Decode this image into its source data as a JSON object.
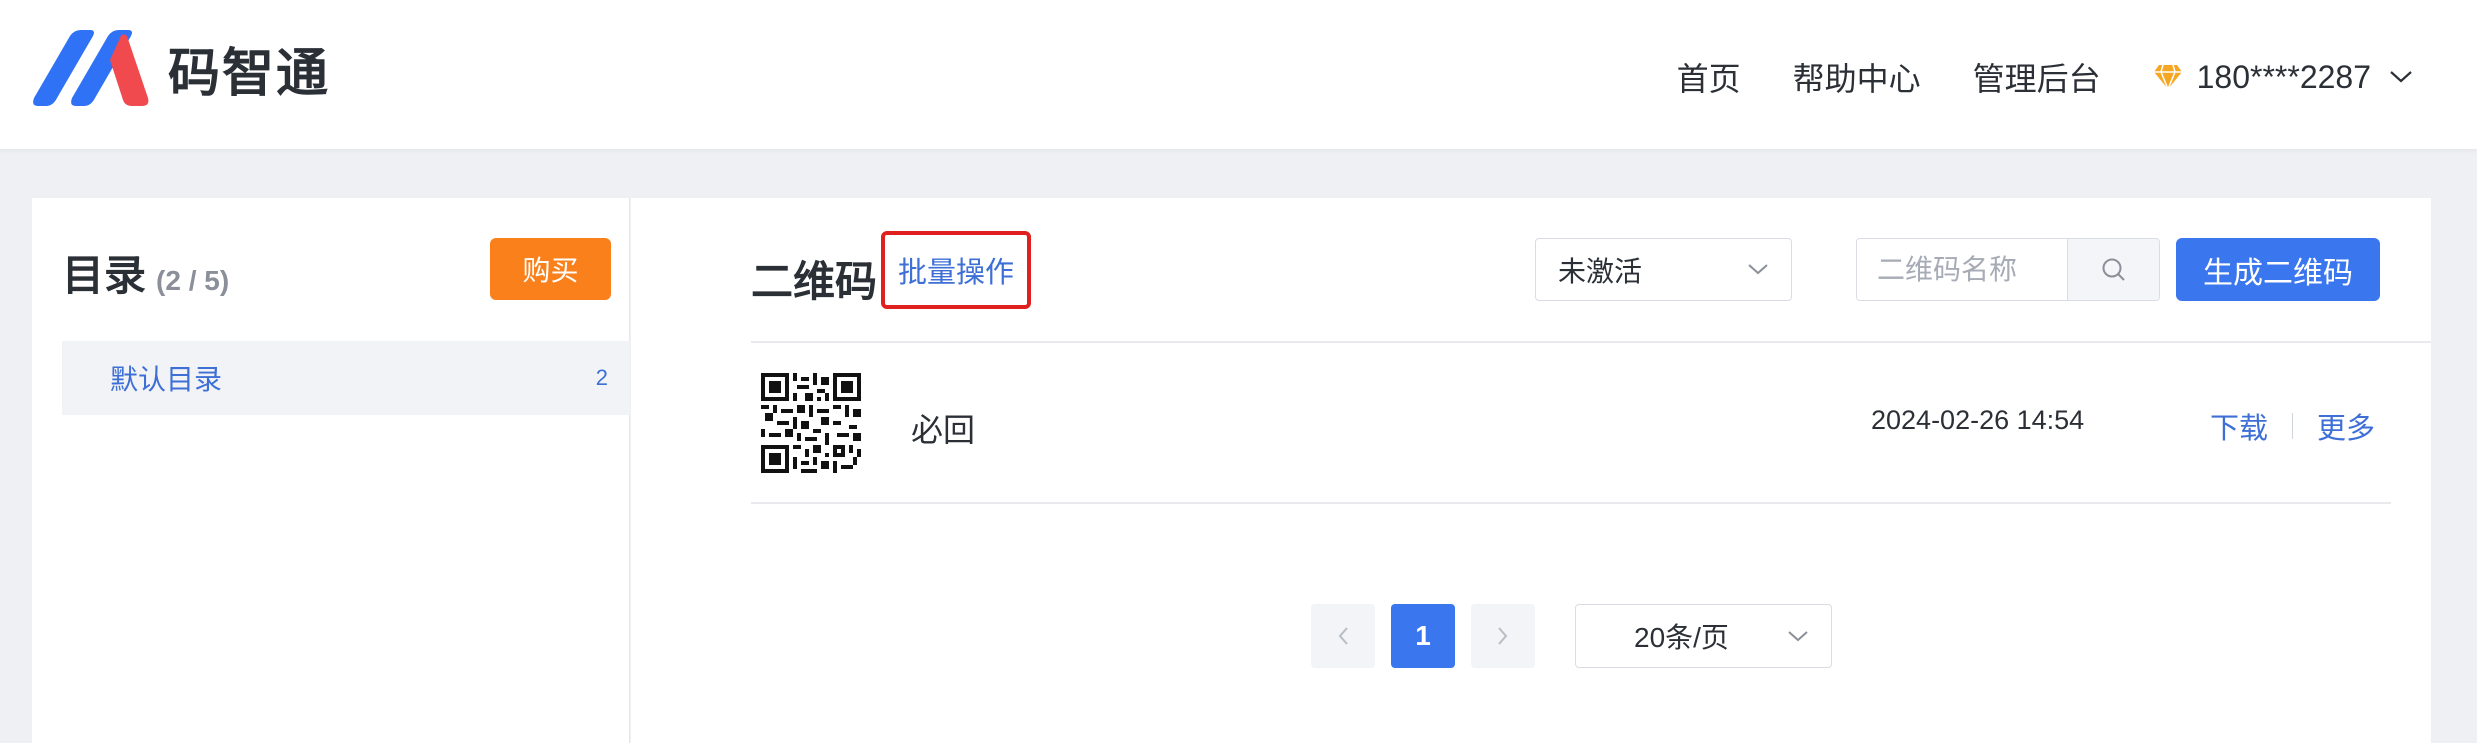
{
  "header": {
    "brand": "码智通",
    "nav": [
      "首页",
      "帮助中心",
      "管理后台"
    ],
    "user": "180****2287",
    "colors": {
      "logo_blue": "#2f72f6",
      "logo_red": "#f04a4e",
      "vip_gem": "#f5a623"
    }
  },
  "sidebar": {
    "title": "目录",
    "count": "(2 / 5)",
    "buy_label": "购买",
    "directories": [
      {
        "label": "默认目录",
        "count": "2"
      }
    ]
  },
  "main": {
    "title": "二维码",
    "batch_label": "批量操作",
    "status_filter": "未激活",
    "search_placeholder": "二维码名称",
    "generate_label": "生成二维码",
    "rows": [
      {
        "name": "必回",
        "time": "2024-02-26 14:54",
        "download": "下载",
        "more": "更多"
      }
    ],
    "pagination": {
      "current": "1",
      "page_size": "20条/页"
    }
  },
  "colors": {
    "primary": "#3a76ee",
    "accent_orange": "#f9801a",
    "highlight_red": "#e0201f",
    "link": "#3d6fd6"
  }
}
